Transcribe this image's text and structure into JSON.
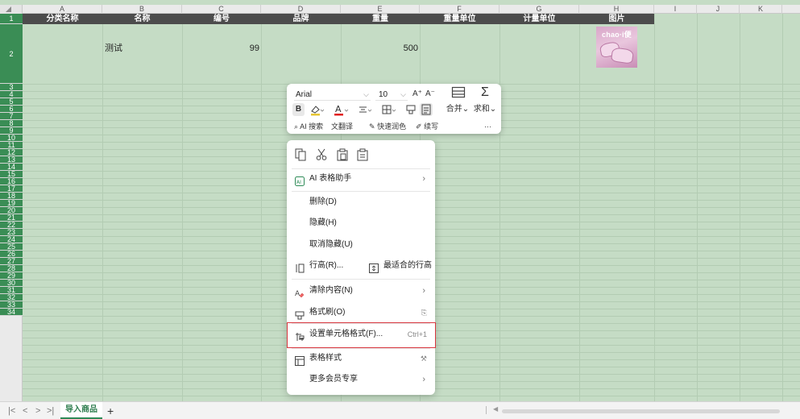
{
  "spreadsheet": {
    "columns": [
      "A",
      "B",
      "C",
      "D",
      "E",
      "F",
      "G",
      "H",
      "I",
      "J",
      "K"
    ],
    "header_row": [
      "分类名称",
      "名称",
      "编号",
      "品牌",
      "重量",
      "重量单位",
      "计量单位",
      "图片"
    ],
    "rows": [
      "1",
      "2",
      "3",
      "4",
      "5",
      "6",
      "7",
      "8",
      "9",
      "10",
      "11",
      "12",
      "13",
      "14",
      "15",
      "16",
      "17",
      "18",
      "19",
      "20",
      "21",
      "22",
      "23",
      "24",
      "25",
      "26",
      "27",
      "28",
      "29",
      "30",
      "31",
      "32",
      "33",
      "34"
    ],
    "data_row": {
      "name": "测试",
      "code": "99",
      "weight": "500",
      "image_brand": "chao·i便"
    },
    "colors": {
      "grid_bg": "#c5dcc5",
      "header_bg": "#4c4c4c",
      "accent": "#2e8b57",
      "highlight": "#d9363e"
    }
  },
  "mini_toolbar": {
    "font_name": "Arial",
    "font_size": "10",
    "increase_font": "A⁺",
    "decrease_font": "A⁻",
    "bold": "B",
    "merge": "合并",
    "sum": "求和",
    "row3": {
      "ai_search": "AI 搜索",
      "translate": "翻译",
      "quick_color": "快速润色",
      "continue_write": "续写",
      "more": "···"
    }
  },
  "context_menu": {
    "quick_icons": [
      "copy-icon",
      "cut-icon",
      "paste-icon",
      "paste-special-icon"
    ],
    "items": {
      "ai_assistant": "AI 表格助手",
      "delete": "删除(D)",
      "hide": "隐藏(H)",
      "unhide": "取消隐藏(U)",
      "row_height": "行高(R)...",
      "best_fit": "最适合的行高",
      "clear_content": "清除内容(N)",
      "format_painter": "格式刷(O)",
      "format_cells": "设置单元格格式(F)...",
      "format_cells_shortcut": "Ctrl+1",
      "table_style": "表格样式",
      "more_vip": "更多会员专享"
    }
  },
  "tab_bar": {
    "sheet_name": "导入商品",
    "add_sheet": "+"
  }
}
